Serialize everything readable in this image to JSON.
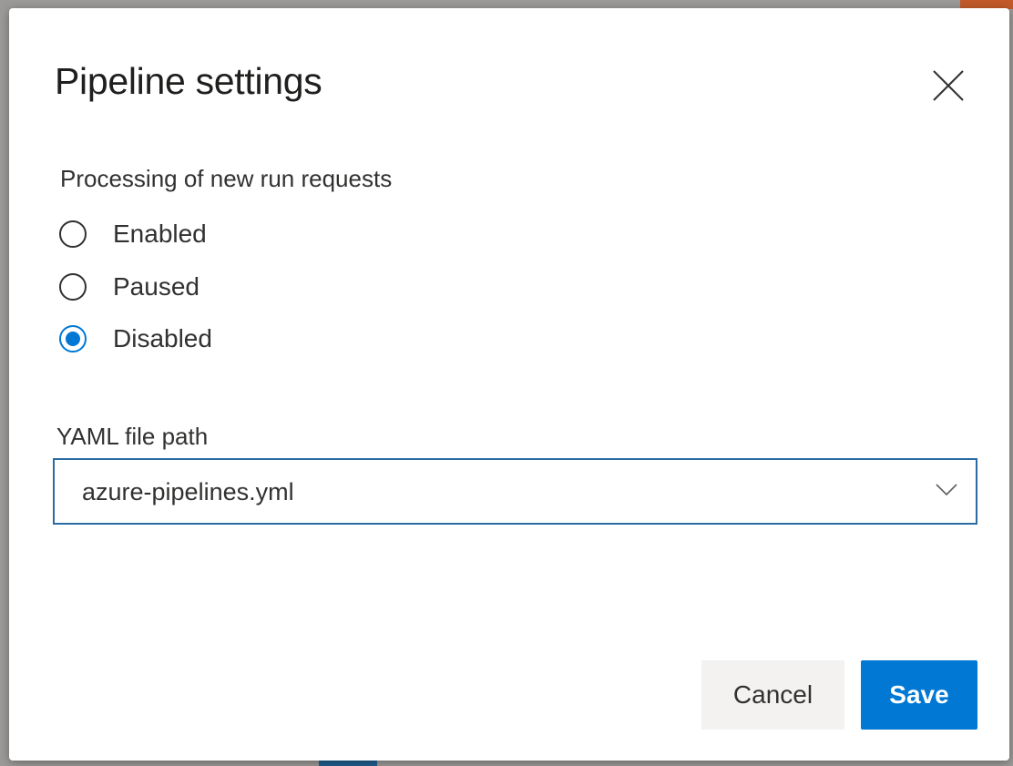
{
  "dialog": {
    "title": "Pipeline settings",
    "close_icon": "close-icon",
    "processing": {
      "label": "Processing of new run requests",
      "options": [
        {
          "label": "Enabled",
          "checked": false
        },
        {
          "label": "Paused",
          "checked": false
        },
        {
          "label": "Disabled",
          "checked": true
        }
      ]
    },
    "yaml": {
      "label": "YAML file path",
      "value": "azure-pipelines.yml",
      "chevron_icon": "chevron-down-icon"
    },
    "buttons": {
      "cancel": "Cancel",
      "save": "Save"
    },
    "colors": {
      "accent": "#0078d4",
      "dropdown_border": "#2b6ba3",
      "text": "#323130"
    }
  }
}
